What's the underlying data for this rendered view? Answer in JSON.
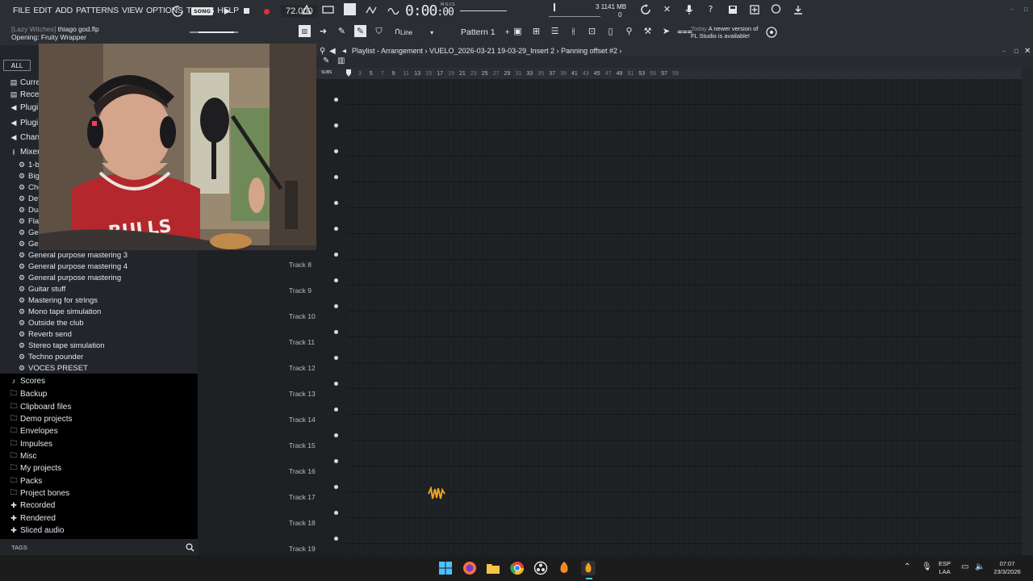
{
  "menu": [
    "FILE",
    "EDIT",
    "ADD",
    "PATTERNS",
    "VIEW",
    "OPTIONS",
    "TOOLS",
    "HELP"
  ],
  "project": {
    "name": "[Lazy Witches]",
    "file": "thiago god.flp",
    "status": "Opening: Fruity Wrapper"
  },
  "transport": {
    "mode": "SONG",
    "tempo": "72.000",
    "time_main": "0:00",
    "time_frac": "00",
    "time_caption": "M:S:CS"
  },
  "cpu": {
    "mem": "1141 MB",
    "polyphony": "0",
    "cpu_top": "3"
  },
  "tools": {
    "snap": "Line",
    "pattern": "Pattern 1"
  },
  "news": {
    "date": "Today",
    "line1": "A newer version of",
    "line2": "FL Studio is available!"
  },
  "browser": {
    "all_label": "ALL",
    "categories": [
      {
        "label": "Curre",
        "icon": "file-icon"
      },
      {
        "label": "Recen",
        "icon": "file-icon"
      },
      {
        "label": "Plugi",
        "icon": "plugin-icon"
      },
      {
        "label": "Plugi",
        "icon": "plugin-icon"
      },
      {
        "label": "Chann",
        "icon": "plugin-icon"
      },
      {
        "label": "Mixer",
        "icon": "mixer-icon"
      }
    ],
    "presets_partial": [
      "1-b",
      "Big",
      "Cho",
      "Def",
      "Dua",
      "Fla",
      "Ger",
      "Ger"
    ],
    "presets": [
      "General purpose mastering 3",
      "General purpose mastering 4",
      "General purpose mastering",
      "Guitar stuff",
      "Mastering for strings",
      "Mono tape simulation",
      "Outside the club",
      "Reverb send",
      "Stereo tape simulation",
      "Techno pounder",
      "VOCES PRESET"
    ],
    "folders": [
      {
        "label": "Scores",
        "icon": "note-icon"
      },
      {
        "label": "Backup",
        "icon": "folder-icon"
      },
      {
        "label": "Clipboard files",
        "icon": "folder-icon"
      },
      {
        "label": "Demo projects",
        "icon": "folder-icon"
      },
      {
        "label": "Envelopes",
        "icon": "folder-icon"
      },
      {
        "label": "Impulses",
        "icon": "folder-icon"
      },
      {
        "label": "Misc",
        "icon": "folder-icon"
      },
      {
        "label": "My projects",
        "icon": "folder-icon"
      },
      {
        "label": "Packs",
        "icon": "folder-icon"
      },
      {
        "label": "Project bones",
        "icon": "folder-icon"
      },
      {
        "label": "Recorded",
        "icon": "plus-icon"
      },
      {
        "label": "Rendered",
        "icon": "plus-icon"
      },
      {
        "label": "Sliced audio",
        "icon": "plus-icon"
      }
    ],
    "tags_label": "TAGS"
  },
  "playlist": {
    "title": "Playlist - Arrangement › VUELO_2026-03-21 19-03-29_Insert 2 › Panning offset #2 ›",
    "ruler_label": "SUBS",
    "ruler_major": [
      "5",
      "9",
      "13",
      "17",
      "21",
      "25",
      "29",
      "33",
      "37",
      "41",
      "45",
      "49",
      "53",
      "57"
    ],
    "ruler_minor": [
      "3",
      "7",
      "11",
      "15",
      "19",
      "23",
      "27",
      "31",
      "35",
      "39",
      "43",
      "47",
      "51",
      "55",
      "59"
    ],
    "tracks": [
      "Track 8",
      "Track 9",
      "Track 10",
      "Track 11",
      "Track 12",
      "Track 13",
      "Track 14",
      "Track 15",
      "Track 16",
      "Track 17",
      "Track 18",
      "Track 19"
    ]
  },
  "tray": {
    "lang1": "ESP",
    "lang2": "LAA",
    "time": "07:07",
    "date": "23/3/2026"
  },
  "colors": {
    "accent": "#f0a020",
    "record": "#e0303a"
  }
}
